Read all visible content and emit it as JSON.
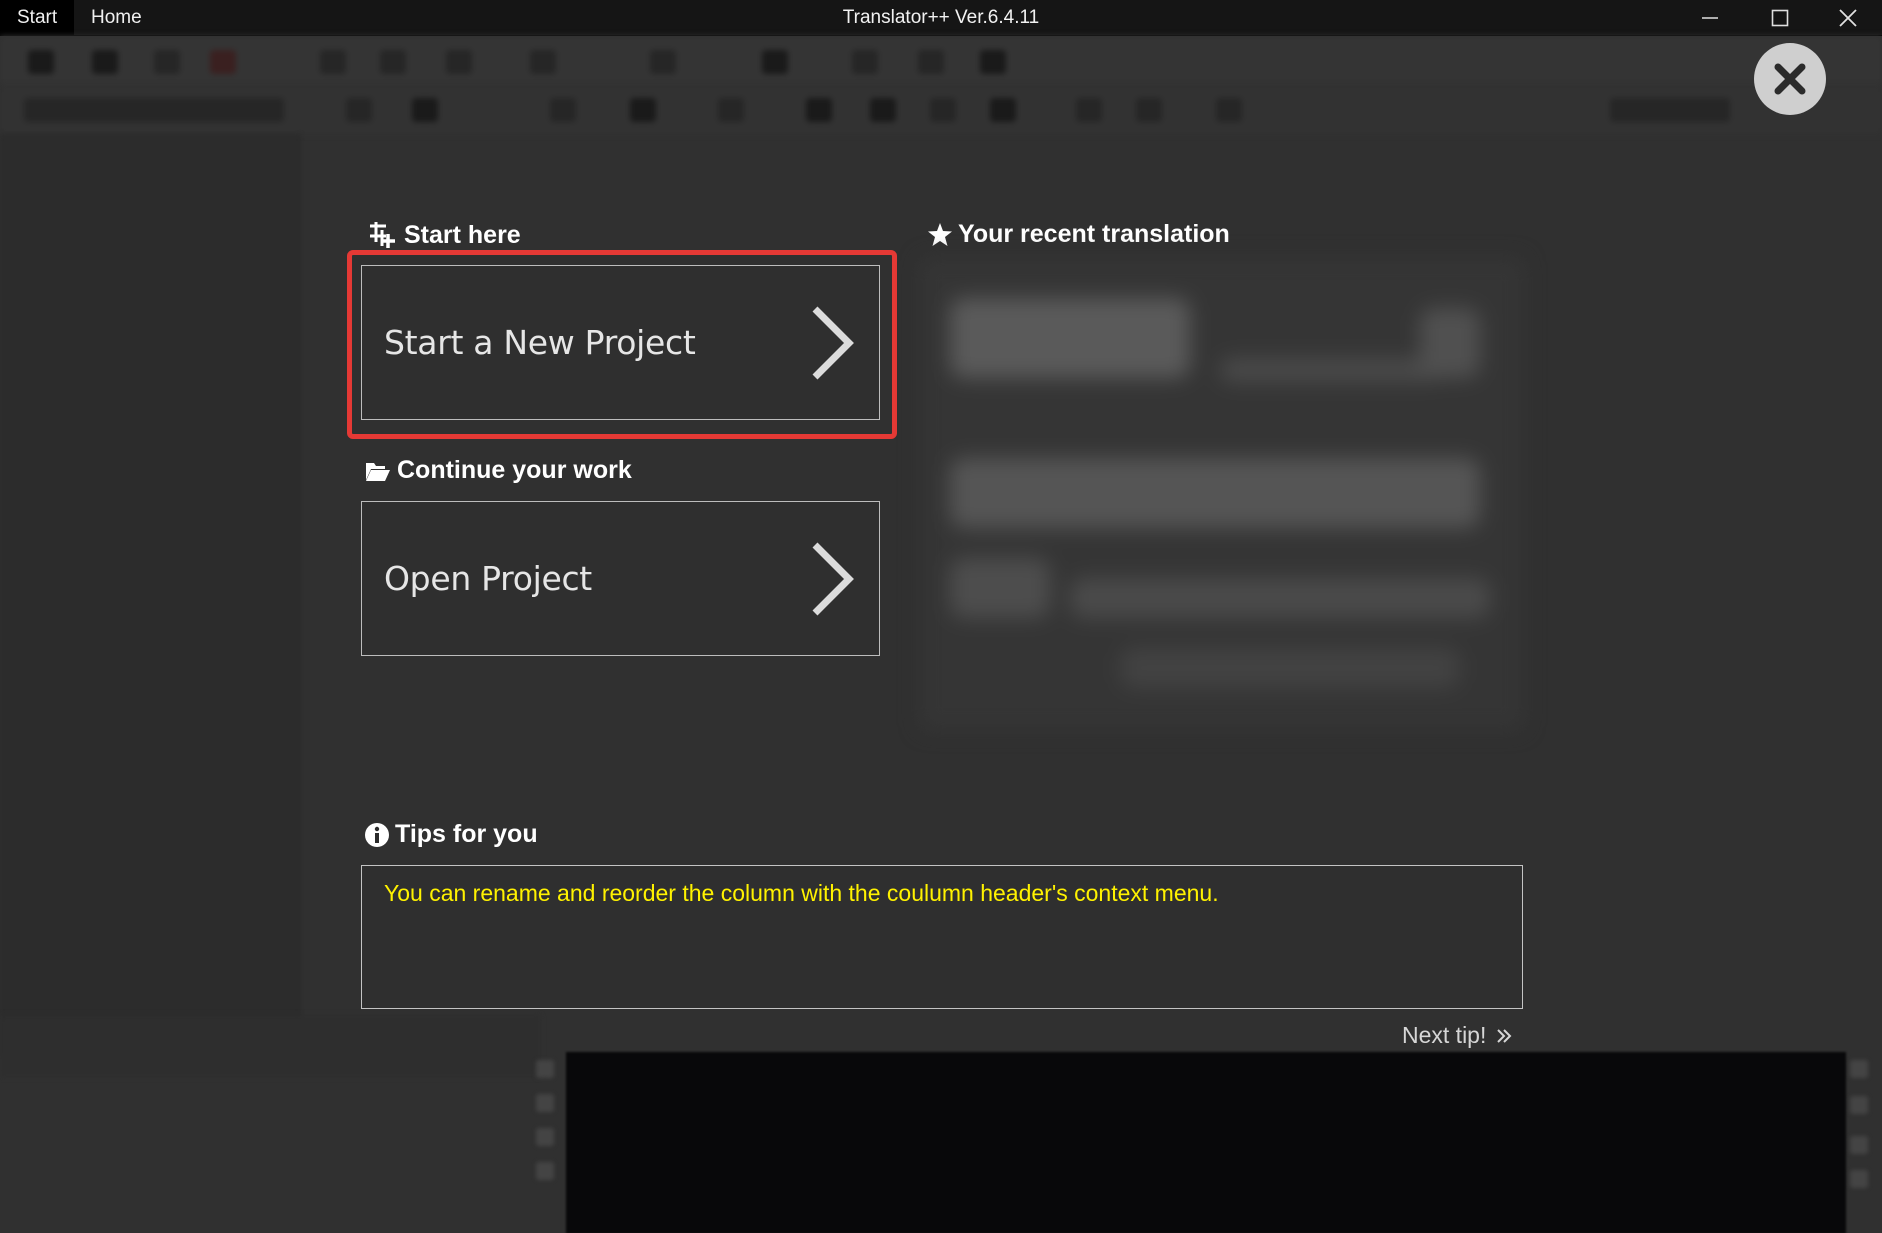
{
  "window": {
    "title": "Translator++ Ver.6.4.11",
    "tabs": [
      {
        "label": "Start",
        "active": true
      },
      {
        "label": "Home",
        "active": false
      }
    ],
    "controls": [
      "minimize-icon",
      "maximize-icon",
      "close-icon"
    ]
  },
  "start_here": {
    "heading": "Start here",
    "icon": "new-project-icon",
    "button_label": "Start a New Project",
    "highlight_color": "#e53935"
  },
  "continue": {
    "heading": "Continue your work",
    "icon": "folder-open-icon",
    "button_label": "Open Project"
  },
  "recent": {
    "heading": "Your recent translation",
    "icon": "star-icon"
  },
  "tips": {
    "heading": "Tips for you",
    "icon": "info-icon",
    "text": "You can rename and reorder the column with the coulumn header's context menu.",
    "text_color": "#fff200",
    "next_label": "Next tip!"
  },
  "overlay": {
    "close_icon": "close-circle-icon"
  }
}
